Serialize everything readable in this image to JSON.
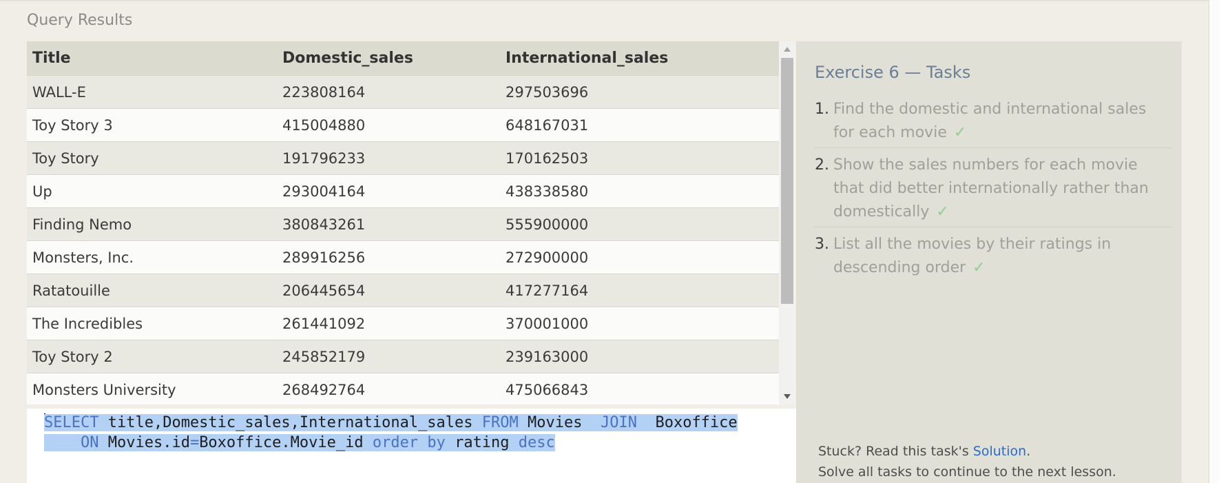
{
  "section_title": "Query Results",
  "table": {
    "columns": [
      "Title",
      "Domestic_sales",
      "International_sales"
    ],
    "rows": [
      [
        "WALL-E",
        "223808164",
        "297503696"
      ],
      [
        "Toy Story 3",
        "415004880",
        "648167031"
      ],
      [
        "Toy Story",
        "191796233",
        "170162503"
      ],
      [
        "Up",
        "293004164",
        "438338580"
      ],
      [
        "Finding Nemo",
        "380843261",
        "555900000"
      ],
      [
        "Monsters, Inc.",
        "289916256",
        "272900000"
      ],
      [
        "Ratatouille",
        "206445654",
        "417277164"
      ],
      [
        "The Incredibles",
        "261441092",
        "370001000"
      ],
      [
        "Toy Story 2",
        "245852179",
        "239163000"
      ],
      [
        "Monsters University",
        "268492764",
        "475066843"
      ]
    ]
  },
  "editor": {
    "line1": [
      {
        "t": "SELECT",
        "k": true
      },
      {
        "t": " title,Domestic_sales,International_sales ",
        "k": false
      },
      {
        "t": "FROM",
        "k": true
      },
      {
        "t": " Movies  ",
        "k": false
      },
      {
        "t": "JOIN",
        "k": true
      },
      {
        "t": "  Boxoffice",
        "k": false
      }
    ],
    "line2": [
      {
        "t": "    ",
        "k": false
      },
      {
        "t": "ON",
        "k": true
      },
      {
        "t": " Movies.id",
        "k": false
      },
      {
        "t": "=",
        "k": true
      },
      {
        "t": "Boxoffice.Movie_id ",
        "k": false
      },
      {
        "t": "order by",
        "k": true
      },
      {
        "t": " rating ",
        "k": false
      },
      {
        "t": "desc",
        "k": true
      }
    ]
  },
  "tasks_panel": {
    "title": "Exercise 6 — Tasks",
    "items": [
      {
        "num": "1.",
        "text": "Find the domestic and international sales for each movie",
        "check": "✓"
      },
      {
        "num": "2.",
        "text": "Show the sales numbers for each movie that did better internationally rather than domestically",
        "check": "✓"
      },
      {
        "num": "3.",
        "text": "List all the movies by their ratings in descending order",
        "check": "✓"
      }
    ],
    "stuck_prefix": "Stuck? Read this task's ",
    "solution_link": "Solution",
    "stuck_suffix": ".",
    "continue_text": "Solve all tasks to continue to the next lesson."
  },
  "colors": {
    "keyword": "#4b72c2",
    "selection": "#b3d0f5",
    "check": "#8fcf8f",
    "link": "#2a6cc9"
  }
}
